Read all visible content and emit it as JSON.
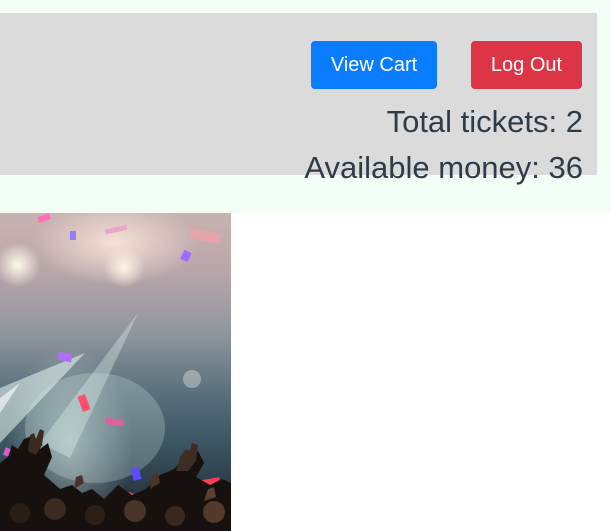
{
  "header": {
    "view_cart_label": "View Cart",
    "log_out_label": "Log Out",
    "total_tickets_text": "Total tickets: 2",
    "available_money_text": "Available money: 36"
  },
  "colors": {
    "page_band": "#f2fdf6",
    "header_panel": "#dbdbdb",
    "primary_button": "#0a7cff",
    "danger_button": "#dc3545",
    "stat_text": "#2f3b47"
  }
}
